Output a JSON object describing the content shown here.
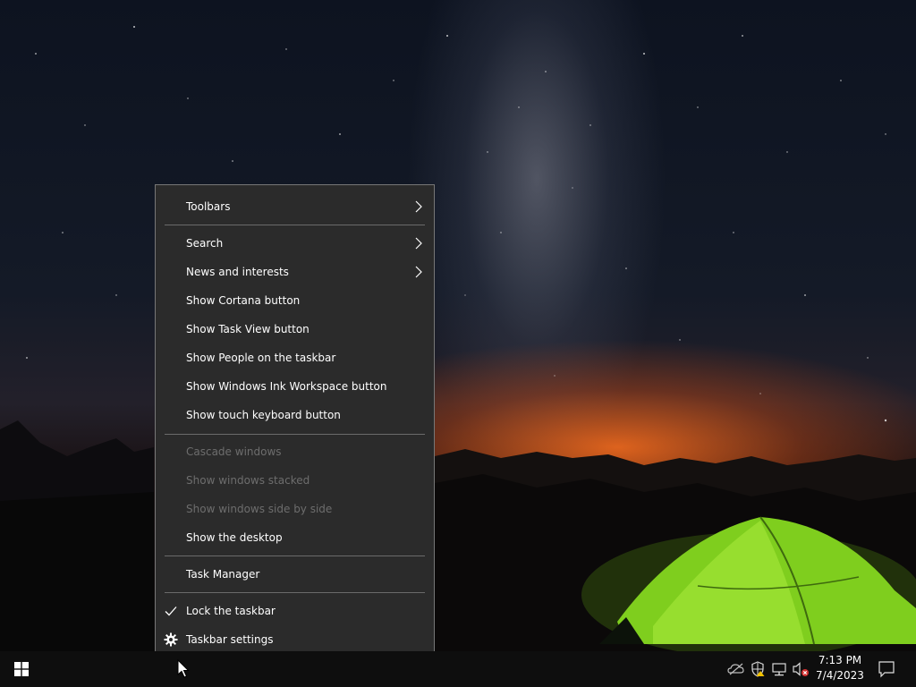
{
  "context_menu": {
    "items": [
      {
        "label": "Toolbars"
      },
      {
        "label": "Search"
      },
      {
        "label": "News and interests"
      },
      {
        "label": "Show Cortana button"
      },
      {
        "label": "Show Task View button"
      },
      {
        "label": "Show People on the taskbar"
      },
      {
        "label": "Show Windows Ink Workspace button"
      },
      {
        "label": "Show touch keyboard button"
      },
      {
        "label": "Cascade windows"
      },
      {
        "label": "Show windows stacked"
      },
      {
        "label": "Show windows side by side"
      },
      {
        "label": "Show the desktop"
      },
      {
        "label": "Task Manager"
      },
      {
        "label": "Lock the taskbar"
      },
      {
        "label": "Taskbar settings"
      }
    ]
  },
  "taskbar": {
    "clock": {
      "time": "7:13 PM",
      "date": "7/4/2023"
    },
    "tray_icons": [
      "onedrive-offline-icon",
      "security-warning-icon",
      "network-icon",
      "volume-muted-icon"
    ]
  },
  "colors": {
    "menu_bg": "#2b2b2b",
    "menu_border": "#777777",
    "disabled_text": "#6d6d6d",
    "taskbar_bg": "#0e0e0e"
  }
}
